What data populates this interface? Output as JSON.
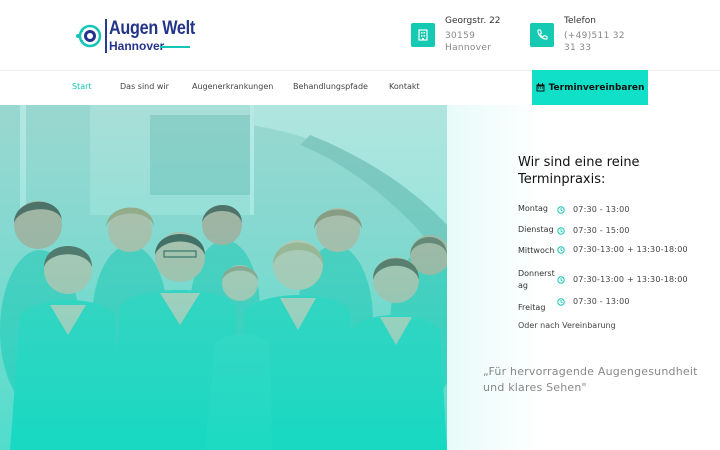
{
  "brand": {
    "title": "Augen Welt",
    "subtitle": "Hannover",
    "accent": "#15c5b5",
    "navy": "#23348a"
  },
  "contact": {
    "address": {
      "label": "Georgstr. 22",
      "value": "30159 Hannover",
      "icon": "building-icon"
    },
    "phone": {
      "label": "Telefon",
      "value": "(+49)511 32 31 33",
      "icon": "phone-icon"
    }
  },
  "nav": {
    "items": [
      {
        "label": "Start",
        "active": true
      },
      {
        "label": "Das sind wir",
        "active": false
      },
      {
        "label": "Augenerkrankungen",
        "active": false
      },
      {
        "label": "Behandlungspfade",
        "active": false
      },
      {
        "label": "Kontakt",
        "active": false
      }
    ],
    "cta_label": "Terminvereinbaren",
    "cta_icon": "calendar-icon",
    "cta_color": "#11e0c8"
  },
  "hours": {
    "title": "Wir sind eine reine Terminpraxis:",
    "rows": [
      {
        "day": "Montag",
        "time": "07:30 - 13:00"
      },
      {
        "day": "Dienstag",
        "time": "07:30 - 15:00"
      },
      {
        "day": "Mittwoch",
        "time": "07:30-13:00 + 13:30-18:00"
      },
      {
        "day": "Donnerstag",
        "time": "07:30-13:00 + 13:30-18:00"
      },
      {
        "day": "Freitag",
        "time": "07:30 - 13:00"
      }
    ],
    "note": "Oder nach Vereinbarung"
  },
  "quote": "„Für hervorragende Augengesundheit und klares Sehen\""
}
